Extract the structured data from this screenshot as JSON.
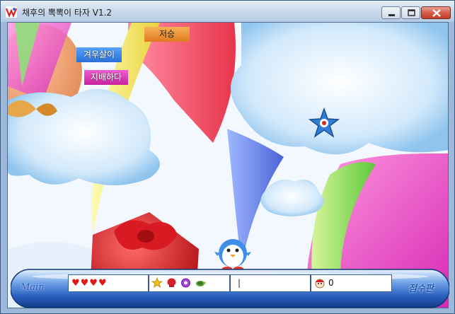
{
  "window": {
    "title": "채후의 뽁뽁이 타자 V1.2",
    "icons": [
      "app-icon",
      "minimize-icon",
      "maximize-icon",
      "close-icon"
    ]
  },
  "game": {
    "falling_words": [
      "저승",
      "겨우살이",
      "지배하다"
    ],
    "character": "penguin-icon",
    "bonus_item": "star-icon"
  },
  "status": {
    "main_label": "Main",
    "lives_text": "♥♥♥♥",
    "lives": 4,
    "items": [
      "star-icon",
      "boxing-glove-icon",
      "purple-orb-icon",
      "turtle-icon"
    ],
    "input_text": "|",
    "score_icon": "face-icon",
    "score": "0",
    "score_label": "점수판"
  },
  "colors": {
    "word_orange": "#e88a2b",
    "word_blue": "#3c86f0",
    "word_magenta": "#db35b8",
    "bar_blue": "#2a5fc0"
  }
}
